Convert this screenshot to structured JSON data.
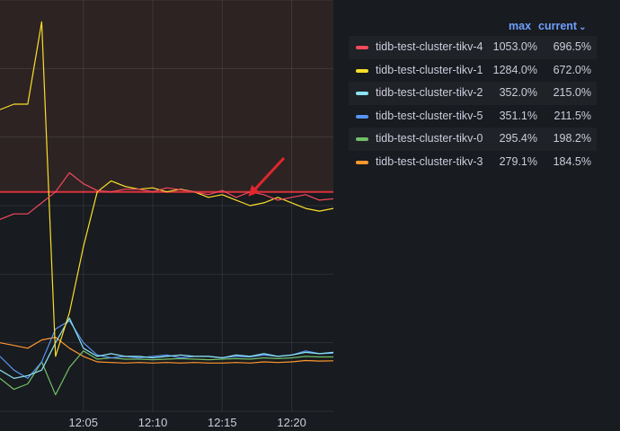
{
  "chart_data": {
    "type": "line",
    "xlim": [
      "11:59",
      "12:23"
    ],
    "ylim": [
      0,
      1500
    ],
    "threshold": 800,
    "x_ticks": [
      "12:05",
      "12:10",
      "12:15",
      "12:20"
    ],
    "grid": true,
    "legend_position": "right",
    "legend_columns": [
      "max",
      "current"
    ],
    "series": [
      {
        "name": "tidb-test-cluster-tikv-4",
        "color": "#f2495c",
        "max": "1053.0%",
        "current": "696.5%",
        "x": [
          "11:59",
          "12:00",
          "12:01",
          "12:02",
          "12:03",
          "12:04",
          "12:05",
          "12:06",
          "12:07",
          "12:08",
          "12:09",
          "12:10",
          "12:11",
          "12:12",
          "12:13",
          "12:14",
          "12:15",
          "12:16",
          "12:17",
          "12:18",
          "12:19",
          "12:20",
          "12:21",
          "12:22",
          "12:23"
        ],
        "y": [
          700,
          720,
          720,
          760,
          800,
          870,
          830,
          805,
          800,
          810,
          810,
          800,
          815,
          808,
          800,
          790,
          805,
          780,
          800,
          790,
          770,
          780,
          790,
          770,
          775
        ]
      },
      {
        "name": "tidb-test-cluster-tikv-1",
        "color": "#fade2a",
        "max": "1284.0%",
        "current": "672.0%",
        "x": [
          "11:59",
          "12:00",
          "12:01",
          "12:02",
          "12:03",
          "12:04",
          "12:05",
          "12:06",
          "12:07",
          "12:08",
          "12:09",
          "12:10",
          "12:11",
          "12:12",
          "12:13",
          "12:14",
          "12:15",
          "12:16",
          "12:17",
          "12:18",
          "12:19",
          "12:20",
          "12:21",
          "12:22",
          "12:23"
        ],
        "y": [
          1100,
          1120,
          1120,
          1420,
          200,
          360,
          600,
          800,
          840,
          820,
          810,
          815,
          800,
          810,
          800,
          780,
          790,
          770,
          750,
          760,
          780,
          760,
          740,
          730,
          740
        ]
      },
      {
        "name": "tidb-test-cluster-tikv-2",
        "color": "#8ae2f2",
        "max": "352.0%",
        "current": "215.0%",
        "x": [
          "11:59",
          "12:00",
          "12:01",
          "12:02",
          "12:03",
          "12:04",
          "12:05",
          "12:06",
          "12:07",
          "12:08",
          "12:09",
          "12:10",
          "12:11",
          "12:12",
          "12:13",
          "12:14",
          "12:15",
          "12:16",
          "12:17",
          "12:18",
          "12:19",
          "12:20",
          "12:21",
          "12:22",
          "12:23"
        ],
        "y": [
          150,
          120,
          130,
          150,
          250,
          340,
          230,
          200,
          210,
          200,
          200,
          195,
          200,
          205,
          200,
          200,
          195,
          205,
          200,
          210,
          200,
          205,
          215,
          210,
          215
        ]
      },
      {
        "name": "tidb-test-cluster-tikv-5",
        "color": "#5794f2",
        "max": "351.1%",
        "current": "211.5%",
        "x": [
          "11:59",
          "12:00",
          "12:01",
          "12:02",
          "12:03",
          "12:04",
          "12:05",
          "12:06",
          "12:07",
          "12:08",
          "12:09",
          "12:10",
          "12:11",
          "12:12",
          "12:13",
          "12:14",
          "12:15",
          "12:16",
          "12:17",
          "12:18",
          "12:19",
          "12:20",
          "12:21",
          "12:22",
          "12:23"
        ],
        "y": [
          200,
          150,
          120,
          180,
          300,
          330,
          250,
          205,
          195,
          200,
          195,
          200,
          205,
          195,
          200,
          200,
          195,
          200,
          198,
          205,
          200,
          205,
          220,
          210,
          212
        ]
      },
      {
        "name": "tidb-test-cluster-tikv-0",
        "color": "#73bf69",
        "max": "295.4%",
        "current": "198.2%",
        "x": [
          "11:59",
          "12:00",
          "12:01",
          "12:02",
          "12:03",
          "12:04",
          "12:05",
          "12:06",
          "12:07",
          "12:08",
          "12:09",
          "12:10",
          "12:11",
          "12:12",
          "12:13",
          "12:14",
          "12:15",
          "12:16",
          "12:17",
          "12:18",
          "12:19",
          "12:20",
          "12:21",
          "12:22",
          "12:23"
        ],
        "y": [
          120,
          80,
          100,
          180,
          60,
          160,
          220,
          190,
          195,
          190,
          190,
          188,
          190,
          192,
          190,
          188,
          190,
          192,
          190,
          195,
          192,
          195,
          200,
          198,
          198
        ]
      },
      {
        "name": "tidb-test-cluster-tikv-3",
        "color": "#ff9830",
        "max": "279.1%",
        "current": "184.5%",
        "x": [
          "11:59",
          "12:00",
          "12:01",
          "12:02",
          "12:03",
          "12:04",
          "12:05",
          "12:06",
          "12:07",
          "12:08",
          "12:09",
          "12:10",
          "12:11",
          "12:12",
          "12:13",
          "12:14",
          "12:15",
          "12:16",
          "12:17",
          "12:18",
          "12:19",
          "12:20",
          "12:21",
          "12:22",
          "12:23"
        ],
        "y": [
          250,
          240,
          230,
          260,
          270,
          230,
          200,
          180,
          178,
          176,
          178,
          176,
          178,
          176,
          178,
          176,
          176,
          178,
          176,
          180,
          178,
          180,
          185,
          183,
          184
        ]
      }
    ]
  }
}
